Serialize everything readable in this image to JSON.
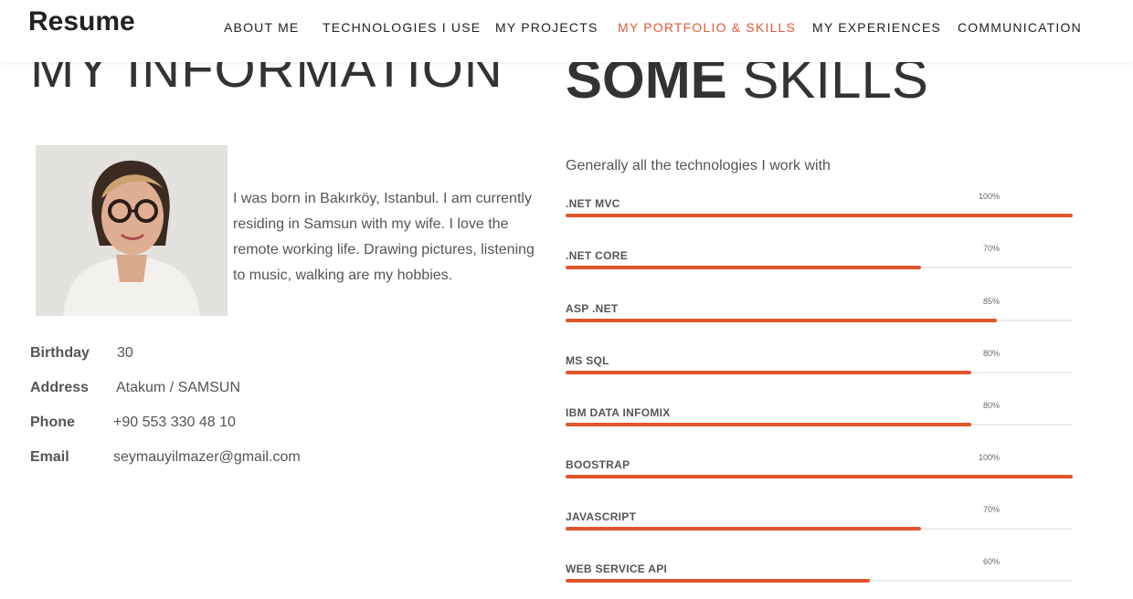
{
  "header": {
    "brand": "Resume",
    "nav": [
      {
        "label": "ABOUT ME",
        "active": false
      },
      {
        "label": "TECHNOLOGIES I USE",
        "active": false
      },
      {
        "label": "MY PROJECTS",
        "active": false
      },
      {
        "label": "MY PORTFOLIO & SKILLS",
        "active": true
      },
      {
        "label": "MY EXPERIENCES",
        "active": false
      },
      {
        "label": "COMMUNICATION",
        "active": false
      }
    ]
  },
  "info": {
    "heading": "MY INFORMATION",
    "about": "I was born in Bakırköy, Istanbul. I am currently residing in Samsun with my wife. I love the remote working life. Drawing pictures, listening to music, walking are my hobbies.",
    "fields": [
      {
        "label": "Birthday",
        "value": "30"
      },
      {
        "label": "Address",
        "value": "Atakum / SAMSUN"
      },
      {
        "label": "Phone",
        "value": "+90 553 330 48 10"
      },
      {
        "label": "Email",
        "value": "seymauyilmazer@gmail.com"
      }
    ]
  },
  "skills": {
    "heading_bold": "SOME",
    "heading_rest": "SKILLS",
    "intro": "Generally all the technologies I work with",
    "items": [
      {
        "name": ".NET MVC",
        "percent_label": "100%",
        "level": 100
      },
      {
        "name": ".NET CORE",
        "percent_label": "70%",
        "level": 70
      },
      {
        "name": "ASP .NET",
        "percent_label": "85%",
        "level": 85
      },
      {
        "name": "MS SQL",
        "percent_label": "80%",
        "level": 80
      },
      {
        "name": "IBM DATA INFOMIX",
        "percent_label": "80%",
        "level": 80
      },
      {
        "name": "BOOSTRAP",
        "percent_label": "100%",
        "level": 100
      },
      {
        "name": "JAVASCRIPT",
        "percent_label": "70%",
        "level": 70
      },
      {
        "name": "WEB SERVICE API",
        "percent_label": "60%",
        "level": 60
      }
    ]
  },
  "colors": {
    "accent": "#e0552c",
    "nav_active": "#e35a35",
    "text": "#555555",
    "heading": "#333333"
  }
}
